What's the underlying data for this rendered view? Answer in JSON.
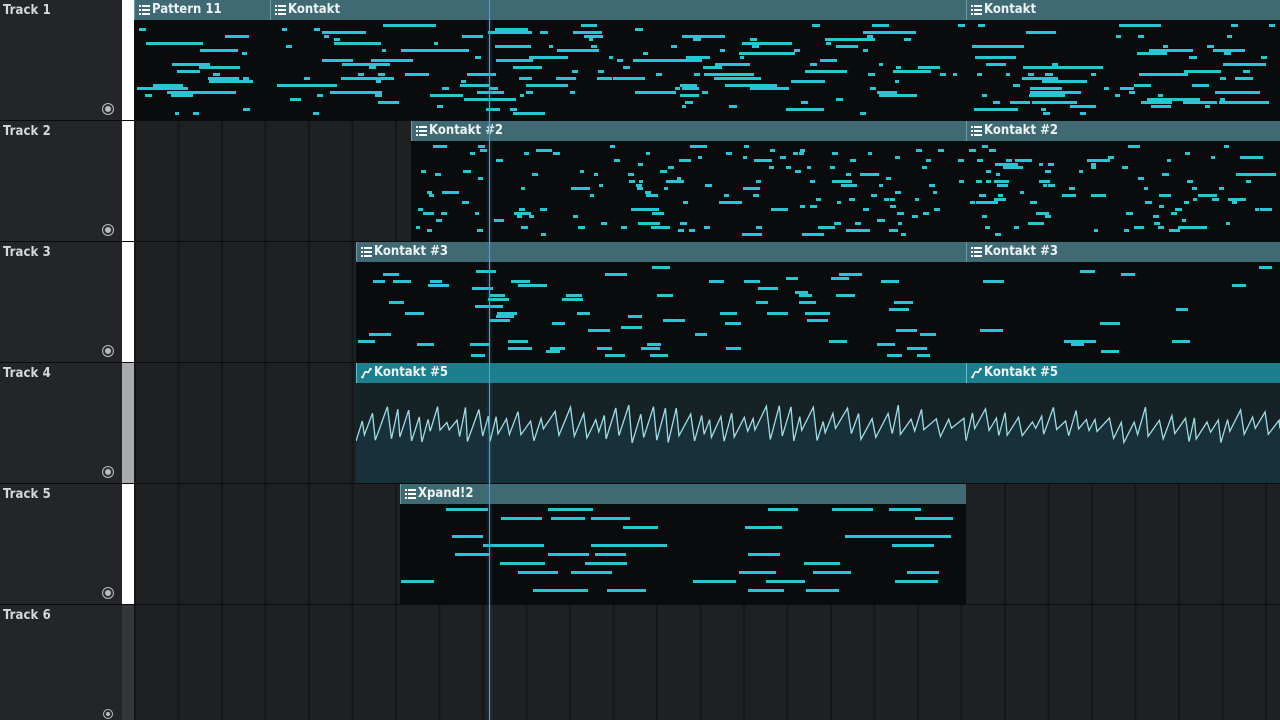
{
  "tracks": [
    {
      "name": "Track 1"
    },
    {
      "name": "Track 2"
    },
    {
      "name": "Track 3"
    },
    {
      "name": "Track 4"
    },
    {
      "name": "Track 5"
    },
    {
      "name": "Track 6"
    }
  ],
  "clips": {
    "pattern_11": "Pattern 11",
    "kontakt_a": "Kontakt",
    "kontakt_b": "Kontakt",
    "kontakt2_a": "Kontakt #2",
    "kontakt2_b": "Kontakt #2",
    "kontakt3_a": "Kontakt #3",
    "kontakt3_b": "Kontakt #3",
    "kontakt5_a": "Kontakt #5",
    "kontakt5_b": "Kontakt #5",
    "xpand2": "Xpand!2"
  },
  "colors": {
    "note": "#27c6d2",
    "clip_header": "#3f6a74",
    "automation_header": "#1c7f8e",
    "playhead": "#3aa9d8"
  },
  "icons": {
    "pattern": "pattern-clip-icon",
    "automation": "automation-clip-icon"
  }
}
